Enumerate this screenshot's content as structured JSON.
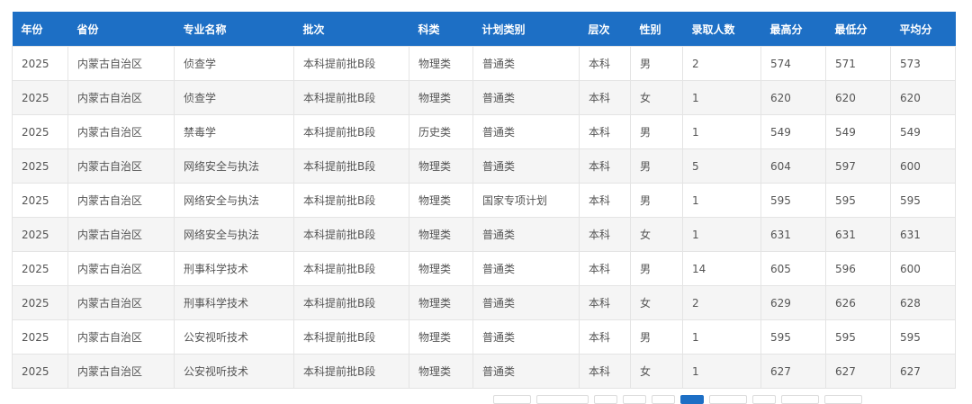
{
  "table": {
    "headers": [
      "年份",
      "省份",
      "专业名称",
      "批次",
      "科类",
      "计划类别",
      "层次",
      "性别",
      "录取人数",
      "最高分",
      "最低分",
      "平均分"
    ],
    "rows": [
      [
        "2025",
        "内蒙古自治区",
        "侦查学",
        "本科提前批B段",
        "物理类",
        "普通类",
        "本科",
        "男",
        "2",
        "574",
        "571",
        "573"
      ],
      [
        "2025",
        "内蒙古自治区",
        "侦查学",
        "本科提前批B段",
        "物理类",
        "普通类",
        "本科",
        "女",
        "1",
        "620",
        "620",
        "620"
      ],
      [
        "2025",
        "内蒙古自治区",
        "禁毒学",
        "本科提前批B段",
        "历史类",
        "普通类",
        "本科",
        "男",
        "1",
        "549",
        "549",
        "549"
      ],
      [
        "2025",
        "内蒙古自治区",
        "网络安全与执法",
        "本科提前批B段",
        "物理类",
        "普通类",
        "本科",
        "男",
        "5",
        "604",
        "597",
        "600"
      ],
      [
        "2025",
        "内蒙古自治区",
        "网络安全与执法",
        "本科提前批B段",
        "物理类",
        "国家专项计划",
        "本科",
        "男",
        "1",
        "595",
        "595",
        "595"
      ],
      [
        "2025",
        "内蒙古自治区",
        "网络安全与执法",
        "本科提前批B段",
        "物理类",
        "普通类",
        "本科",
        "女",
        "1",
        "631",
        "631",
        "631"
      ],
      [
        "2025",
        "内蒙古自治区",
        "刑事科学技术",
        "本科提前批B段",
        "物理类",
        "普通类",
        "本科",
        "男",
        "14",
        "605",
        "596",
        "600"
      ],
      [
        "2025",
        "内蒙古自治区",
        "刑事科学技术",
        "本科提前批B段",
        "物理类",
        "普通类",
        "本科",
        "女",
        "2",
        "629",
        "626",
        "628"
      ],
      [
        "2025",
        "内蒙古自治区",
        "公安视听技术",
        "本科提前批B段",
        "物理类",
        "普通类",
        "本科",
        "男",
        "1",
        "595",
        "595",
        "595"
      ],
      [
        "2025",
        "内蒙古自治区",
        "公安视听技术",
        "本科提前批B段",
        "物理类",
        "普通类",
        "本科",
        "女",
        "1",
        "627",
        "627",
        "627"
      ]
    ]
  },
  "colors": {
    "header_bg": "#1d6fc5",
    "header_text": "#ffffff",
    "cell_text": "#555555",
    "stripe_bg": "#f5f5f5"
  }
}
